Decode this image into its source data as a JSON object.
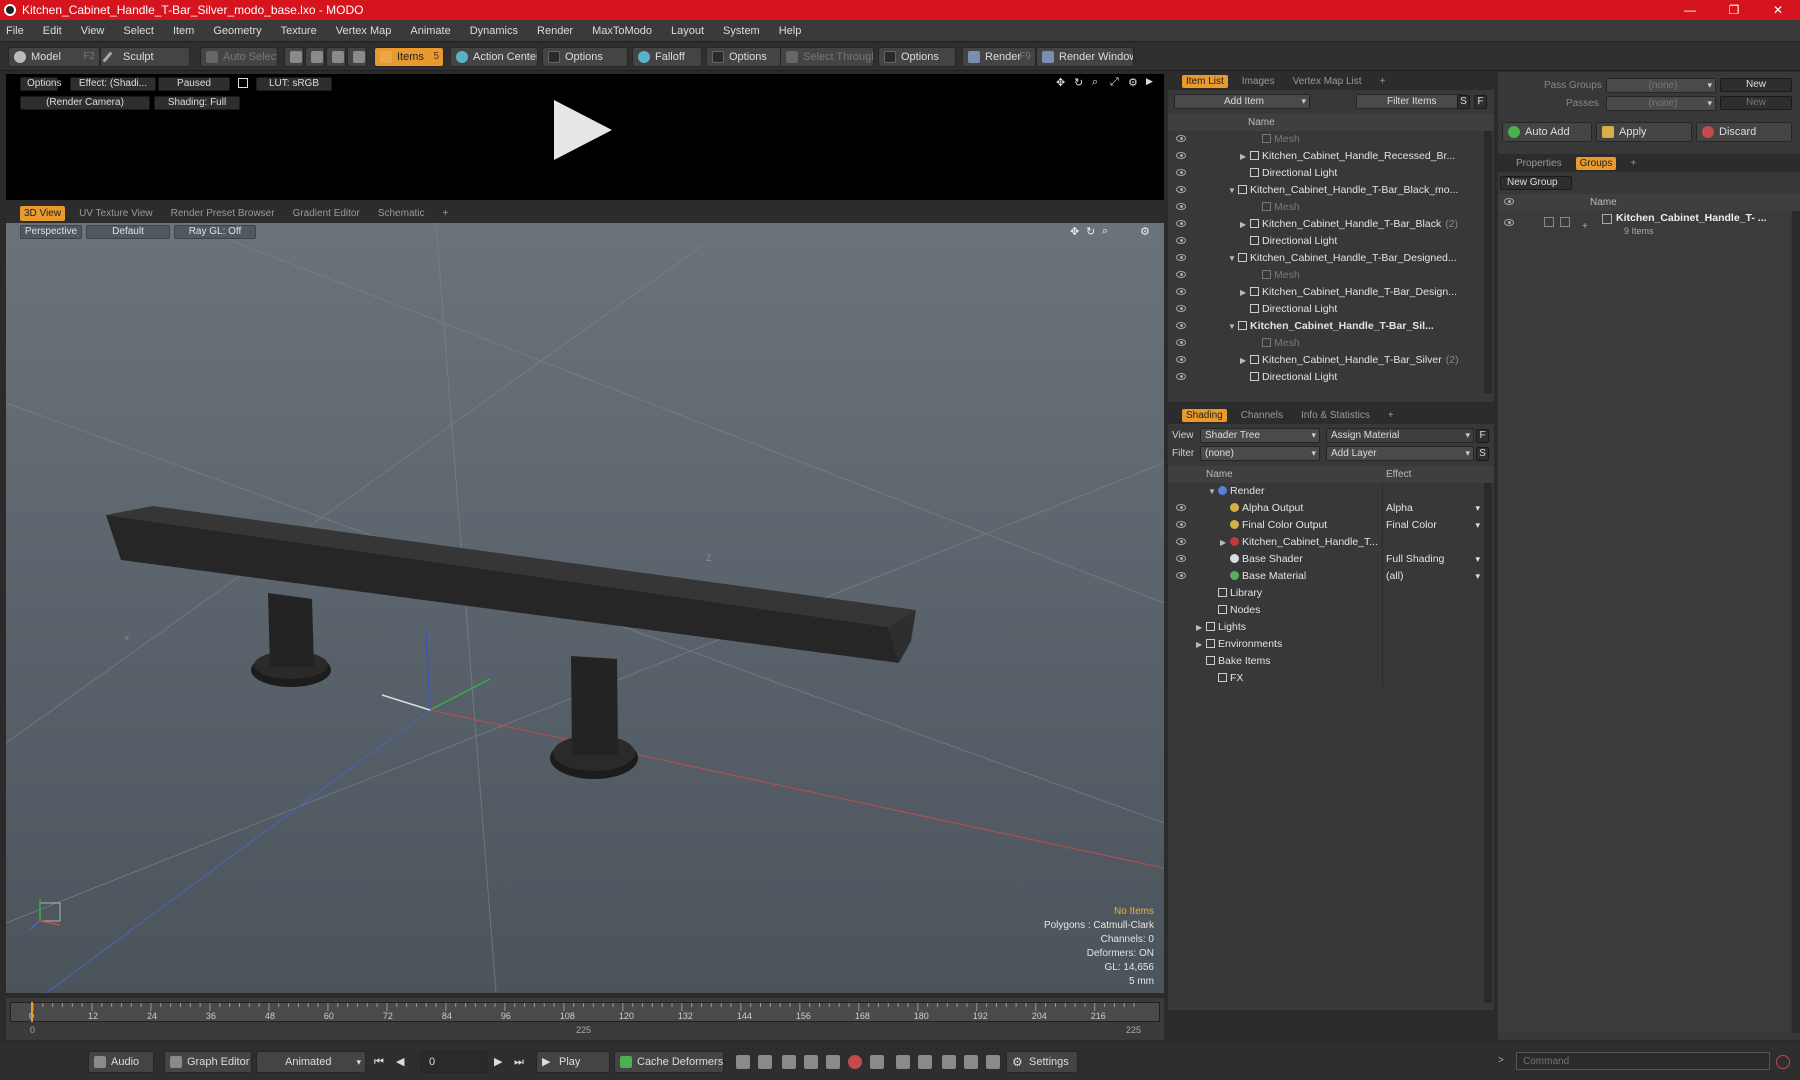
{
  "window": {
    "title": "Kitchen_Cabinet_Handle_T-Bar_Silver_modo_base.lxo - MODO",
    "minimize": "—",
    "maximize": "❐",
    "close": "✕"
  },
  "menu": [
    "File",
    "Edit",
    "View",
    "Select",
    "Item",
    "Geometry",
    "Texture",
    "Vertex Map",
    "Animate",
    "Dynamics",
    "Render",
    "MaxToModo",
    "Layout",
    "System",
    "Help"
  ],
  "toolbar": {
    "model": "Model",
    "model_key": "F2",
    "sculpt": "Sculpt",
    "auto_select": "Auto Select",
    "items": "Items",
    "items_key": "5",
    "action_center": "Action Center",
    "options1": "Options",
    "falloff": "Falloff",
    "options2": "Options",
    "select_through": "Select Through",
    "options3": "Options",
    "render": "Render",
    "render_key": "F9",
    "render_window": "Render Window"
  },
  "preview": {
    "options": "Options",
    "effect": "Effect: (Shadi...",
    "paused": "Paused",
    "lut": "LUT: sRGB",
    "camera": "(Render Camera)",
    "shading": "Shading: Full"
  },
  "viewport_tabs": [
    "3D View",
    "UV Texture View",
    "Render Preset Browser",
    "Gradient Editor",
    "Schematic",
    "+"
  ],
  "viewport": {
    "perspective": "Perspective",
    "default": "Default",
    "raygl": "Ray GL: Off",
    "no_items": "No Items",
    "polygons": "Polygons : Catmull-Clark",
    "channels": "Channels: 0",
    "deformers": "Deformers: ON",
    "gl": "GL: 14,656",
    "unit": "5 mm",
    "axis_label": "Z"
  },
  "timeline": {
    "ticks": [
      "0",
      "12",
      "24",
      "36",
      "48",
      "60",
      "72",
      "84",
      "96",
      "108",
      "120",
      "132",
      "144",
      "156",
      "168",
      "180",
      "192",
      "204",
      "216"
    ],
    "start": "0",
    "mid": "225",
    "end": "225"
  },
  "bottom": {
    "audio": "Audio",
    "graph_editor": "Graph Editor",
    "animated": "Animated",
    "frame": "0",
    "play": "Play",
    "cache_deformers": "Cache Deformers",
    "settings": "Settings",
    "command_placeholder": "Command"
  },
  "item_list": {
    "tabs": [
      "Item List",
      "Images",
      "Vertex Map List",
      "+"
    ],
    "add_item": "Add Item",
    "filter_items": "Filter Items",
    "s": "S",
    "f": "F",
    "name_col": "Name",
    "rows": [
      {
        "label": "Mesh",
        "indent": 3,
        "dim": true,
        "arrow": ""
      },
      {
        "label": "Kitchen_Cabinet_Handle_Recessed_Br...",
        "indent": 2,
        "dim": false,
        "arrow": "▶"
      },
      {
        "label": "Directional Light",
        "indent": 2,
        "dim": false,
        "arrow": ""
      },
      {
        "label": "Kitchen_Cabinet_Handle_T-Bar_Black_mo...",
        "indent": 1,
        "dim": false,
        "arrow": "▼"
      },
      {
        "label": "Mesh",
        "indent": 3,
        "dim": true,
        "arrow": ""
      },
      {
        "label": "Kitchen_Cabinet_Handle_T-Bar_Black",
        "suffix": "(2)",
        "indent": 2,
        "dim": false,
        "arrow": "▶"
      },
      {
        "label": "Directional Light",
        "indent": 2,
        "dim": false,
        "arrow": ""
      },
      {
        "label": "Kitchen_Cabinet_Handle_T-Bar_Designed...",
        "indent": 1,
        "dim": false,
        "arrow": "▼"
      },
      {
        "label": "Mesh",
        "indent": 3,
        "dim": true,
        "arrow": ""
      },
      {
        "label": "Kitchen_Cabinet_Handle_T-Bar_Design...",
        "indent": 2,
        "dim": false,
        "arrow": "▶"
      },
      {
        "label": "Directional Light",
        "indent": 2,
        "dim": false,
        "arrow": ""
      },
      {
        "label": "Kitchen_Cabinet_Handle_T-Bar_Sil...",
        "indent": 1,
        "dim": false,
        "bold": true,
        "arrow": "▼"
      },
      {
        "label": "Mesh",
        "indent": 3,
        "dim": true,
        "arrow": ""
      },
      {
        "label": "Kitchen_Cabinet_Handle_T-Bar_Silver",
        "suffix": "(2)",
        "indent": 2,
        "dim": false,
        "arrow": "▶"
      },
      {
        "label": "Directional Light",
        "indent": 2,
        "dim": false,
        "arrow": ""
      }
    ]
  },
  "shading": {
    "tabs": [
      "Shading",
      "Channels",
      "Info & Statistics",
      "+"
    ],
    "view_label": "View",
    "view_value": "Shader Tree",
    "assign_material": "Assign Material",
    "filter_label": "Filter",
    "filter_value": "(none)",
    "add_layer": "Add Layer",
    "f": "F",
    "s": "S",
    "name_col": "Name",
    "effect_col": "Effect",
    "rows": [
      {
        "label": "Render",
        "effect": "",
        "indent": 1,
        "eye": false,
        "icon": "#5b7fd6",
        "arrow": "▼"
      },
      {
        "label": "Alpha Output",
        "effect": "Alpha",
        "indent": 2,
        "eye": true,
        "icon": "#d6b046",
        "arrow": ""
      },
      {
        "label": "Final Color Output",
        "effect": "Final Color",
        "indent": 2,
        "eye": true,
        "icon": "#d6b046",
        "arrow": ""
      },
      {
        "label": "Kitchen_Cabinet_Handle_T...",
        "effect": "",
        "indent": 2,
        "eye": true,
        "icon": "#c23a3a",
        "arrow": "▶"
      },
      {
        "label": "Base Shader",
        "effect": "Full Shading",
        "indent": 2,
        "eye": true,
        "icon": "#dddddd",
        "arrow": ""
      },
      {
        "label": "Base Material",
        "effect": "(all)",
        "indent": 2,
        "eye": true,
        "icon": "#56b05a",
        "arrow": ""
      },
      {
        "label": "Library",
        "effect": "",
        "indent": 1,
        "eye": false,
        "icon": "",
        "arrow": ""
      },
      {
        "label": "Nodes",
        "effect": "",
        "indent": 1,
        "eye": false,
        "icon": "",
        "arrow": ""
      },
      {
        "label": "Lights",
        "effect": "",
        "indent": 0,
        "eye": false,
        "icon": "",
        "arrow": "▶"
      },
      {
        "label": "Environments",
        "effect": "",
        "indent": 0,
        "eye": false,
        "icon": "",
        "arrow": "▶"
      },
      {
        "label": "Bake Items",
        "effect": "",
        "indent": 0,
        "eye": false,
        "icon": "",
        "arrow": ""
      },
      {
        "label": "FX",
        "effect": "",
        "indent": 1,
        "eye": false,
        "icon": "",
        "arrow": ""
      }
    ]
  },
  "right": {
    "pass_groups": "Pass Groups",
    "passes": "Passes",
    "none1": "(none)",
    "none2": "(none)",
    "new1": "New",
    "new2": "New",
    "auto_add": "Auto Add",
    "apply": "Apply",
    "discard": "Discard",
    "tabs": [
      "Properties",
      "Groups",
      "+"
    ],
    "new_group": "New Group",
    "name_col": "Name",
    "group_name": "Kitchen_Cabinet_Handle_T- ...",
    "group_count": "9 Items"
  },
  "colors": {
    "accent": "#e89a2c",
    "title_red": "#d5141e"
  }
}
